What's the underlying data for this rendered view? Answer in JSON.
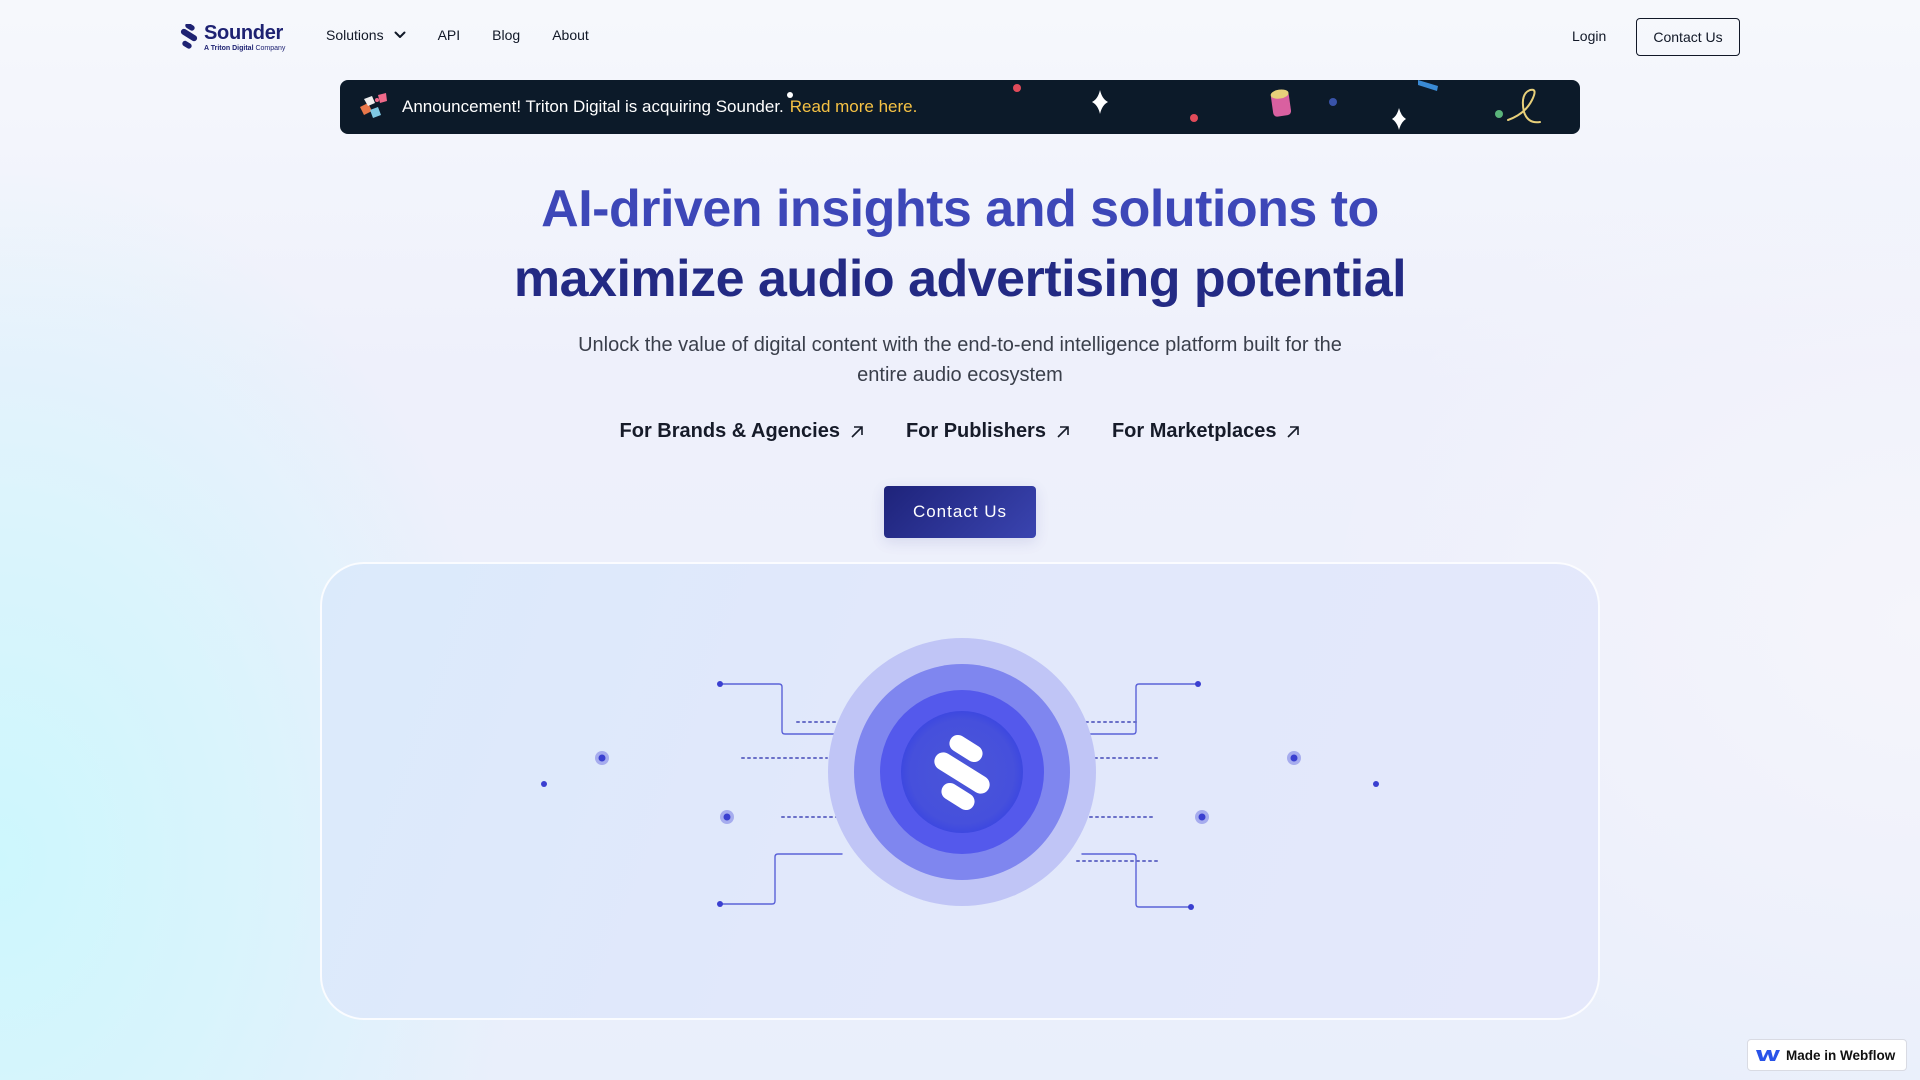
{
  "brand": {
    "name": "Sounder",
    "tagline_bold": "A Triton Digital",
    "tagline_rest": " Company",
    "primary_color": "#1e2272",
    "accent_color": "#3d47b8"
  },
  "nav": {
    "items": [
      {
        "label": "Solutions",
        "has_dropdown": true,
        "icon": "chevron-down-icon"
      },
      {
        "label": "API"
      },
      {
        "label": "Blog"
      },
      {
        "label": "About"
      }
    ],
    "login_label": "Login",
    "contact_label": "Contact Us"
  },
  "announcement": {
    "icon": "puzzle-icon",
    "text": "Announcement! Triton Digital is acquiring Sounder.",
    "link_label": "Read more here.",
    "background": "#0c1a29",
    "link_color": "#f6c244"
  },
  "hero": {
    "title_line1": "AI-driven insights and solutions to",
    "title_line2": "maximize audio advertising potential",
    "subtitle": "Unlock the value of digital content with the end-to-end intelligence platform built for the entire audio ecosystem",
    "audience_links": [
      {
        "label": "For Brands & Agencies",
        "icon": "arrow-up-right-icon"
      },
      {
        "label": "For Publishers",
        "icon": "arrow-up-right-icon"
      },
      {
        "label": "For Marketplaces",
        "icon": "arrow-up-right-icon"
      }
    ],
    "cta_label": "Contact Us"
  },
  "illustration": {
    "center_icon": "sounder-logo-icon",
    "description": "concentric circles with circuit lines"
  },
  "webflow_badge": {
    "label": "Made in Webflow",
    "icon": "webflow-icon"
  }
}
